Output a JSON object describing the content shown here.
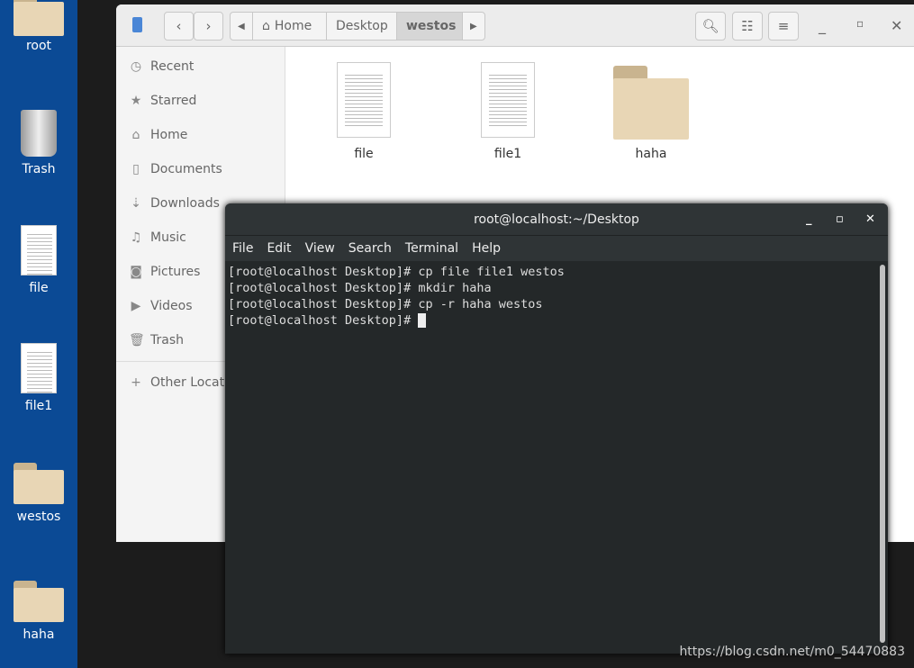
{
  "desktop": {
    "icons": [
      {
        "label": "root",
        "type": "home-folder"
      },
      {
        "label": "Trash",
        "type": "trash"
      },
      {
        "label": "file",
        "type": "document"
      },
      {
        "label": "file1",
        "type": "document"
      },
      {
        "label": "westos",
        "type": "folder"
      },
      {
        "label": "haha",
        "type": "folder"
      }
    ]
  },
  "files": {
    "path": [
      "Home",
      "Desktop",
      "westos"
    ],
    "sidebar": [
      {
        "label": "Recent",
        "icon": "clock-icon"
      },
      {
        "label": "Starred",
        "icon": "star-icon"
      },
      {
        "label": "Home",
        "icon": "home-icon"
      },
      {
        "label": "Documents",
        "icon": "document-icon"
      },
      {
        "label": "Downloads",
        "icon": "download-icon"
      },
      {
        "label": "Music",
        "icon": "music-icon"
      },
      {
        "label": "Pictures",
        "icon": "camera-icon"
      },
      {
        "label": "Videos",
        "icon": "video-icon"
      },
      {
        "label": "Trash",
        "icon": "trash-icon"
      },
      {
        "label": "Other Locations",
        "icon": "plus-icon"
      }
    ],
    "items": [
      {
        "label": "file",
        "type": "document"
      },
      {
        "label": "file1",
        "type": "document"
      },
      {
        "label": "haha",
        "type": "folder"
      }
    ]
  },
  "terminal": {
    "title": "root@localhost:~/Desktop",
    "menu": [
      "File",
      "Edit",
      "View",
      "Search",
      "Terminal",
      "Help"
    ],
    "lines": [
      "[root@localhost Desktop]# cp file file1 westos",
      "[root@localhost Desktop]# mkdir haha",
      "[root@localhost Desktop]# cp -r haha westos",
      "[root@localhost Desktop]# "
    ]
  },
  "watermark": "https://blog.csdn.net/m0_54470883"
}
